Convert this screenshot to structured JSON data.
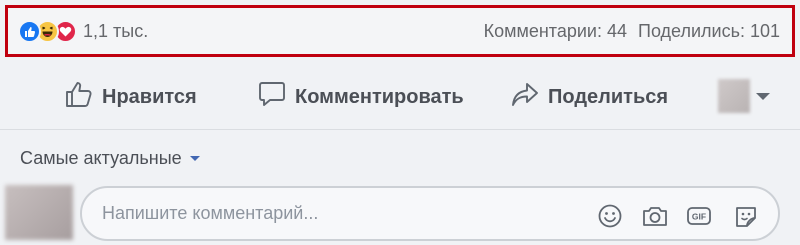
{
  "reactions": {
    "icons": [
      "like-icon",
      "haha-icon",
      "love-icon"
    ],
    "count": "1,1 тыс.",
    "comments_label": "Комментарии: 44",
    "shares_label": "Поделились: 101",
    "colors": {
      "like": "#1877f2",
      "haha": "#f7c544",
      "love": "#e0264a",
      "highlight_border": "#c0000f"
    }
  },
  "actions": {
    "like_label": "Нравится",
    "comment_label": "Комментировать",
    "share_label": "Поделиться"
  },
  "comments": {
    "sort_label": "Самые актуальные",
    "input_placeholder": "Напишите комментарий...",
    "input_icons": [
      "emoji-icon",
      "camera-icon",
      "gif-icon",
      "sticker-icon"
    ]
  }
}
